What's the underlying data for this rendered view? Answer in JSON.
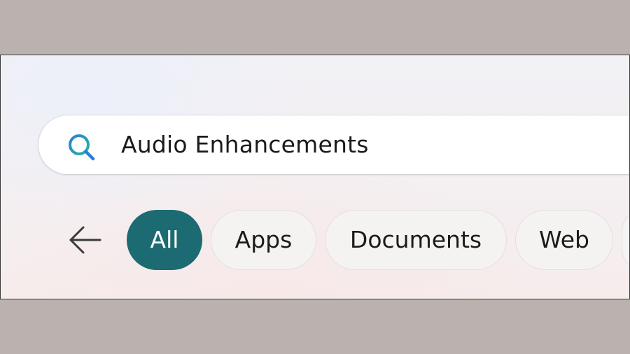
{
  "search": {
    "query": "Audio Enhancements",
    "icon": "search-icon",
    "icon_colors": [
      "#2a7fd6",
      "#27b59a"
    ]
  },
  "filters": {
    "back_icon": "back-arrow-icon",
    "chips": [
      {
        "label": "All",
        "selected": true
      },
      {
        "label": "Apps",
        "selected": false
      },
      {
        "label": "Documents",
        "selected": false
      },
      {
        "label": "Web",
        "selected": false
      }
    ],
    "accent_color": "#1c6b73"
  }
}
